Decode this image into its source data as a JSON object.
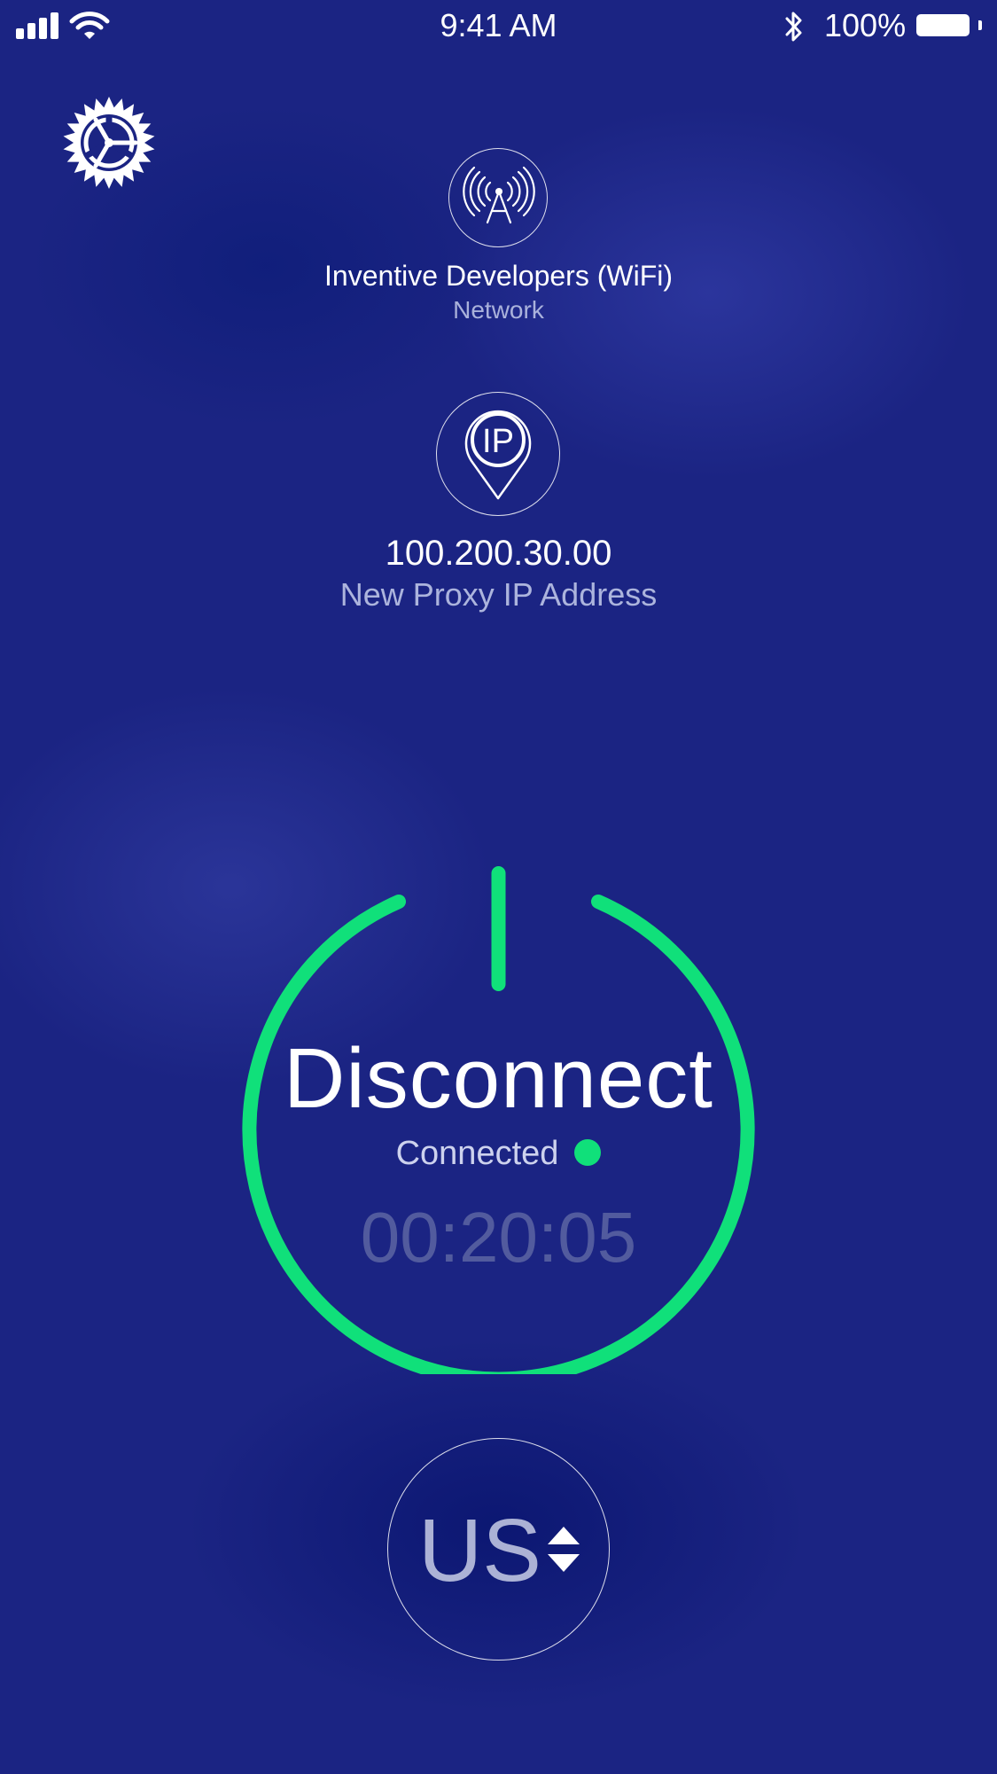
{
  "status_bar": {
    "time": "9:41 AM",
    "battery_percent": "100%",
    "icons": [
      "cellular-signal-icon",
      "wifi-icon",
      "bluetooth-icon",
      "battery-icon"
    ]
  },
  "settings": {
    "icon": "settings-gear-icon"
  },
  "network": {
    "name": "Inventive Developers (WiFi)",
    "label": "Network",
    "icon": "antenna-tower-icon"
  },
  "proxy": {
    "ip": "100.200.30.00",
    "label": "New Proxy IP Address",
    "icon": "ip-location-pin-icon"
  },
  "connection": {
    "button_label": "Disconnect",
    "status": "Connected",
    "timer": "00:20:05",
    "icon": "power-icon"
  },
  "region": {
    "code": "US",
    "icon": "sort-arrows-icon"
  },
  "colors": {
    "background": "#1b2483",
    "accent_green": "#10e07a",
    "text": "#ffffff"
  }
}
